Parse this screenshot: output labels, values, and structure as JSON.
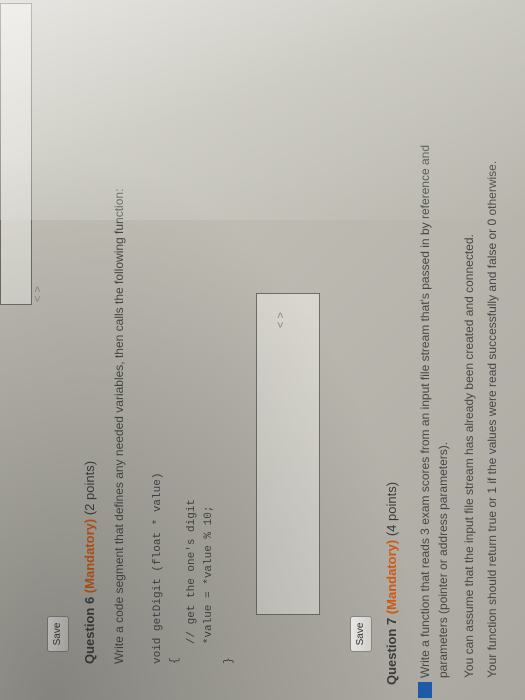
{
  "q5": {
    "save_label": "Save"
  },
  "q6": {
    "number_label": "Question 6",
    "mandatory_label": "(Mandatory)",
    "points_label": "(2 points)",
    "prompt": "Write a code segment that defines any needed variables, then calls the following function:",
    "code_lines": [
      "void getDigit (float * value)",
      "{",
      "   // get the one's digit",
      "   *value = *value % 10;",
      "}"
    ],
    "scroll_arrows": "< >",
    "save_label": "Save"
  },
  "q7": {
    "number_label": "Question 7",
    "mandatory_label": "(Mandatory)",
    "points_label": "(4 points)",
    "lines": [
      "Write a function that reads 3 exam scores from an input file stream that's passed in by reference and",
      "parameters (pointer or address parameters).",
      "You can assume that the input file stream has already been created and connected.",
      "Your function should return true or 1 if the values were read successfully and false or 0 otherwise."
    ]
  },
  "colors": {
    "mandatory": "#d05a12",
    "accent_mark": "#1e5aa8"
  }
}
